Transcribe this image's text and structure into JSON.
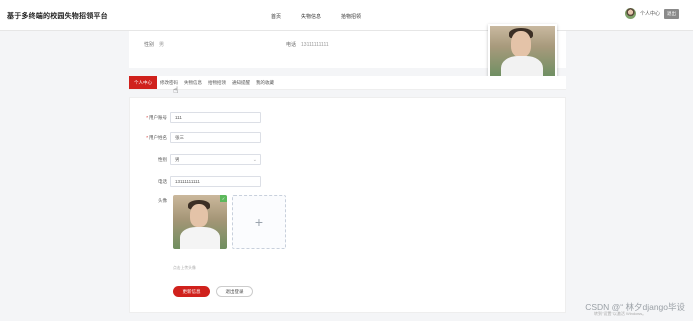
{
  "header": {
    "brand": "基于多终端的校园失物招领平台",
    "nav": [
      "首页",
      "失物信息",
      "拾物招领"
    ],
    "user_link": "个人中心",
    "logout_label": "退出"
  },
  "summary": {
    "gender_label": "性别",
    "gender_value": "男",
    "phone_label": "电话",
    "phone_value": "13111111111"
  },
  "tabs": [
    "个人中心",
    "修改密码",
    "失物信息",
    "拾物招领",
    "通知提醒",
    "我的收藏"
  ],
  "form": {
    "account_label": "用户账号",
    "account_value": "111",
    "name_label": "用户姓名",
    "name_value": "张三",
    "gender_label": "性别",
    "gender_value": "男",
    "phone_label": "电话",
    "phone_value": "13111111111",
    "avatar_label": "头像",
    "upload_hint": "点击上传头像",
    "update_button": "更新信息",
    "logout_button": "退出登录"
  },
  "watermarks": {
    "windows": "转到\"设置\"以激活 Windows。",
    "csdn": "CSDN @“ 林夕django毕设"
  }
}
